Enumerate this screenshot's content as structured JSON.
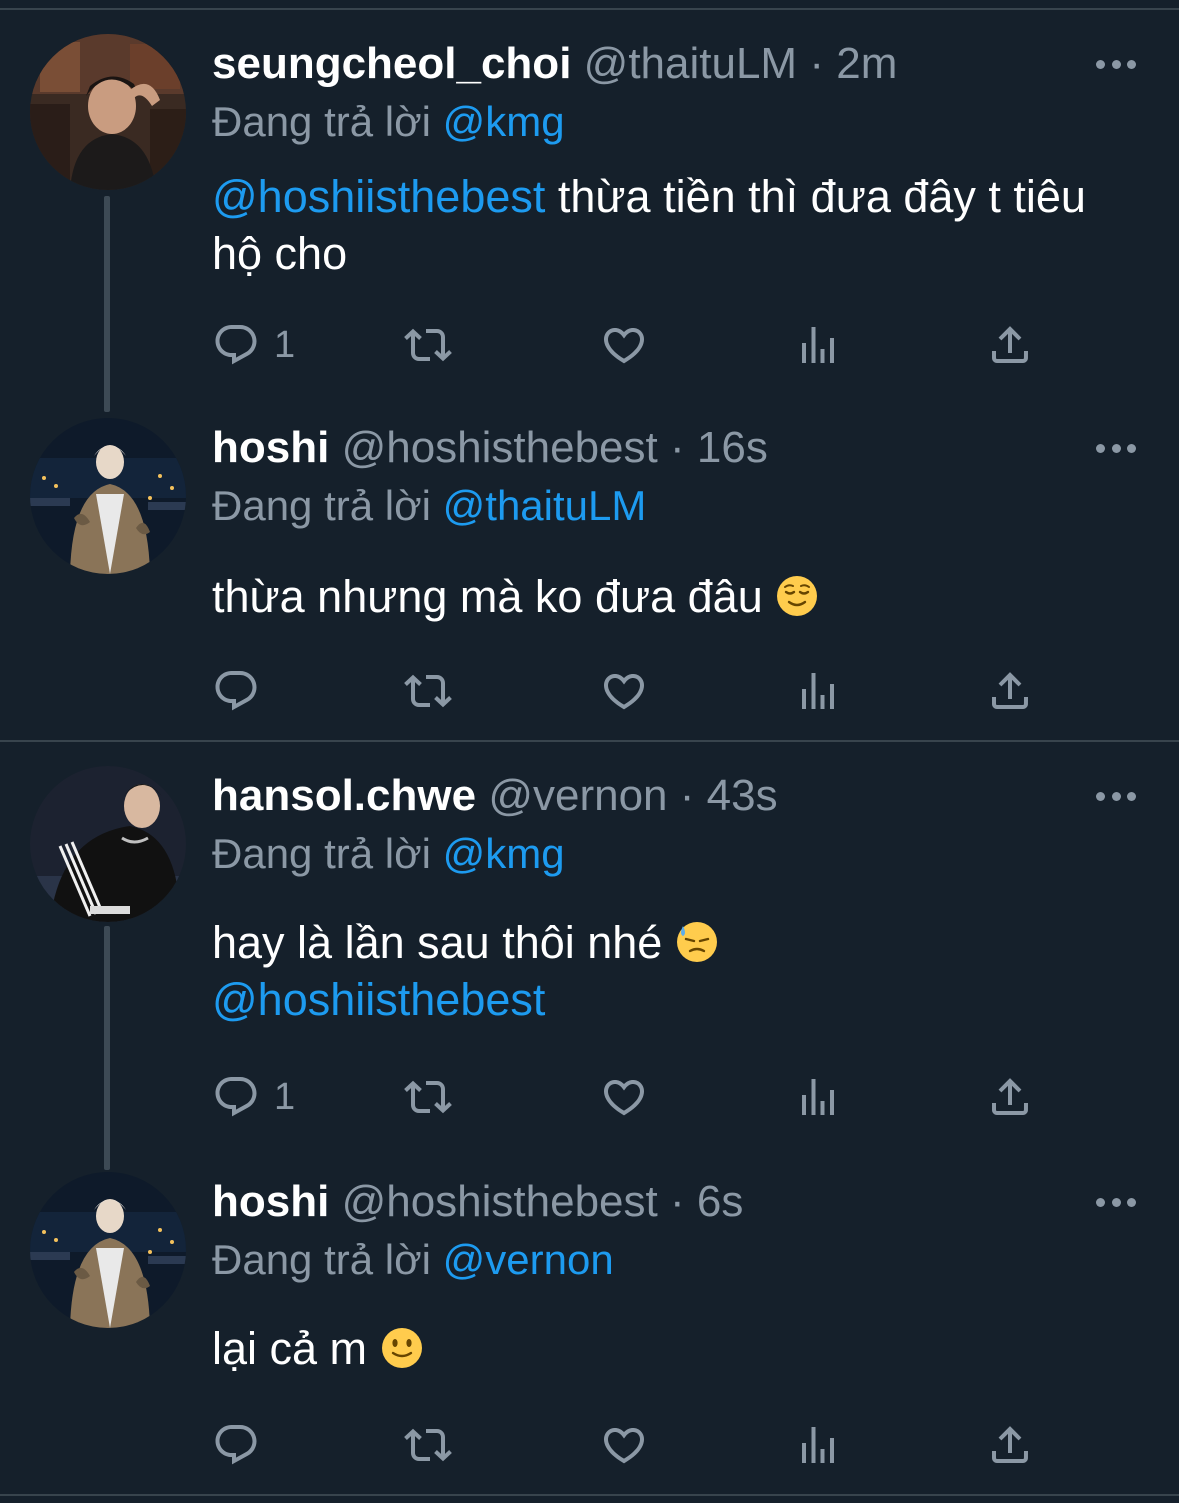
{
  "colors": {
    "background": "#15202b",
    "text": "#ffffff",
    "secondary_text": "#8b98a5",
    "mention": "#1d9bf0",
    "divider": "#38444d"
  },
  "reply_prefix": "Đang trả lời",
  "tweets": [
    {
      "display_name": "seungcheol_choi",
      "handle": "@thaituLM",
      "separator": "·",
      "time": "2m",
      "reply_to": "@kmg",
      "text_mention": "@hoshiisthebest",
      "text": "thừa tiền thì đưa đây t tiêu hộ cho",
      "reply_count": "1",
      "icons": [
        "reply-icon",
        "retweet-icon",
        "like-icon",
        "analytics-icon",
        "share-icon"
      ]
    },
    {
      "display_name": "hoshi",
      "handle": "@hoshisthebest",
      "separator": "·",
      "time": "16s",
      "reply_to": "@thaituLM",
      "text": "thừa nhưng mà ko đưa đâu",
      "emoji": "relieved-face-emoji",
      "reply_count": ""
    },
    {
      "display_name": "hansol.chwe",
      "handle": "@vernon",
      "separator": "·",
      "time": "43s",
      "reply_to": "@kmg",
      "text": "hay là lần sau thôi nhé",
      "emoji": "downcast-face-with-sweat-emoji",
      "text_mention_after": "@hoshiisthebest",
      "reply_count": "1"
    },
    {
      "display_name": "hoshi",
      "handle": "@hoshisthebest",
      "separator": "·",
      "time": "6s",
      "reply_to": "@vernon",
      "text": "lại cả m",
      "emoji": "slightly-smiling-face-emoji",
      "reply_count": ""
    }
  ]
}
